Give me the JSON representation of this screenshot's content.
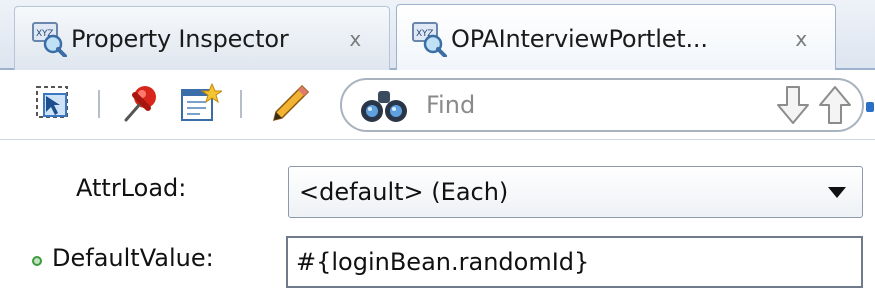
{
  "tabs": [
    {
      "label": "Property Inspector",
      "icon": "property-inspector-icon",
      "active": false
    },
    {
      "label": "OPAInterviewPortlet...",
      "icon": "property-inspector-icon",
      "active": true
    }
  ],
  "tab_close_glyph": "x",
  "toolbar": {
    "icons": [
      "select-component-icon",
      "pin-icon",
      "edit-properties-icon",
      "pencil-icon"
    ],
    "find_placeholder": "Find",
    "find_icon": "binoculars-icon",
    "nav_icons": [
      "arrow-down-icon",
      "arrow-up-icon"
    ]
  },
  "properties": [
    {
      "label": "AttrLoad:",
      "type": "select",
      "value": "<default> (Each)"
    },
    {
      "label": "DefaultValue:",
      "type": "text",
      "value": "#{loginBean.randomId}",
      "modified_indicator": true
    }
  ],
  "colors": {
    "tab_border": "#9db2cf",
    "modified_dot": "#3f9a3f",
    "accent": "#2b6fc6"
  }
}
